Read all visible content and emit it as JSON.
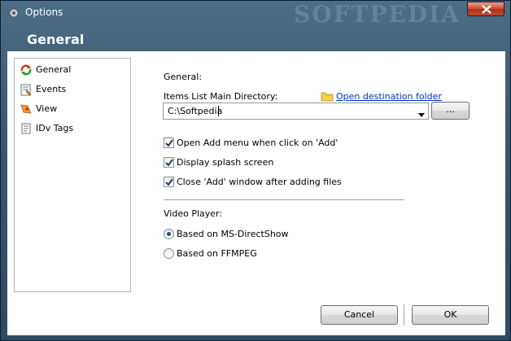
{
  "window": {
    "title": "Options",
    "watermark": "SOFTPEDIA"
  },
  "header": {
    "title": "General"
  },
  "sidebar": {
    "items": [
      {
        "label": "General",
        "icon": "general-icon"
      },
      {
        "label": "Events",
        "icon": "events-icon"
      },
      {
        "label": "View",
        "icon": "view-icon"
      },
      {
        "label": "IDv Tags",
        "icon": "tags-icon"
      }
    ]
  },
  "general": {
    "section_label": "General:",
    "dir_label": "Items List Main Directory:",
    "open_folder_link": "Open destination folder",
    "dir_value": "C:\\Softpedia",
    "browse_label": "...",
    "options": [
      {
        "label": "Open Add menu when click on 'Add'",
        "checked": true
      },
      {
        "label": "Display splash screen",
        "checked": true
      },
      {
        "label": "Close 'Add' window after adding files",
        "checked": true
      }
    ]
  },
  "video": {
    "section_label": "Video Player:",
    "options": [
      {
        "label": "Based on MS-DirectShow",
        "selected": true
      },
      {
        "label": "Based on FFMPEG",
        "selected": false
      }
    ]
  },
  "footer": {
    "cancel_label": "Cancel",
    "ok_label": "OK"
  },
  "colors": {
    "accent": "#0033cc",
    "titlebar": "#3a5870",
    "close": "#c84a30"
  }
}
